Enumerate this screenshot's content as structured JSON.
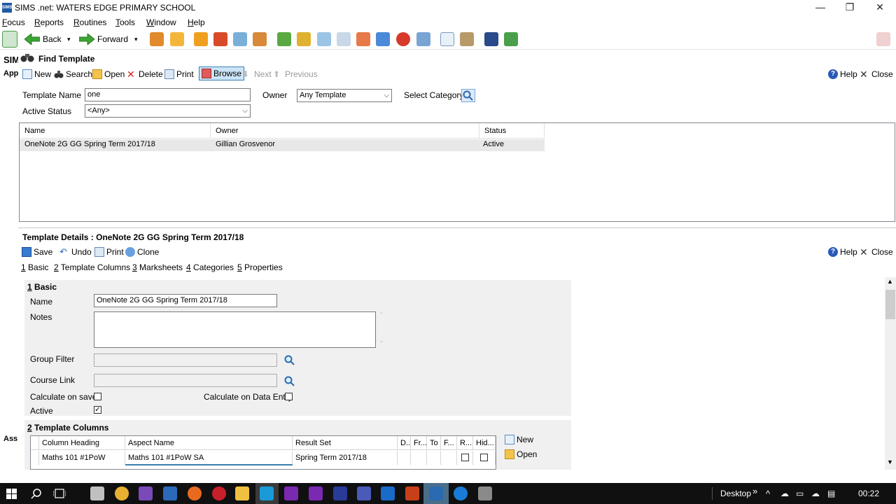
{
  "window": {
    "title": "SIMS .net: WATERS EDGE PRIMARY SCHOOL",
    "app_icon_text": "SIMS",
    "minimize": "—",
    "restore": "❐",
    "close": "✕"
  },
  "menu": {
    "focus_first": "F",
    "focus_rest": "ocus",
    "reports_first": "R",
    "reports_rest": "eports",
    "routines_first": "R",
    "routines_rest": "outines",
    "tools_first": "T",
    "tools_rest": "ools",
    "window_first": "W",
    "window_rest": "indow",
    "help_first": "H",
    "help_rest": "elp"
  },
  "toolbar": {
    "back_label": "Back",
    "forward_label": "Forward",
    "dropdown_glyph": "▾"
  },
  "leftstrip": {
    "line1": "SIM",
    "line2": "App",
    "line3": "Ass"
  },
  "find": {
    "title": "Find Template",
    "cmd_new": "New",
    "cmd_search": "Search",
    "cmd_open": "Open",
    "cmd_delete": "Delete",
    "cmd_print": "Print",
    "cmd_browse": "Browse",
    "cmd_next": "Next",
    "cmd_previous": "Previous",
    "cmd_help": "Help",
    "cmd_close": "Close",
    "template_name_label": "Template Name",
    "template_name_value": "one",
    "owner_label": "Owner",
    "owner_value": "Any Template",
    "select_category_label": "Select Category",
    "active_status_label": "Active Status",
    "active_status_value": "<Any>",
    "columns": {
      "name": "Name",
      "owner": "Owner",
      "status": "Status"
    },
    "rows": [
      {
        "name": "OneNote 2G GG Spring Term 2017/18",
        "owner": "Gillian Grosvenor",
        "status": "Active"
      }
    ]
  },
  "details": {
    "title": "Template Details : OneNote 2G GG Spring Term 2017/18",
    "cmd_save": "Save",
    "cmd_undo": "Undo",
    "cmd_print": "Print",
    "cmd_clone": "Clone",
    "cmd_help": "Help",
    "cmd_close": "Close",
    "tabs": [
      {
        "num": "1",
        "label": " Basic"
      },
      {
        "num": "2",
        "label": " Template Columns"
      },
      {
        "num": "3",
        "label": " Marksheets"
      },
      {
        "num": "4",
        "label": " Categories"
      },
      {
        "num": "5",
        "label": " Properties"
      }
    ],
    "basic": {
      "section_num": "1",
      "section_title": " Basic",
      "name_label": "Name",
      "name_value": "OneNote 2G GG Spring Term 2017/18",
      "notes_label": "Notes",
      "notes_value": "",
      "group_filter_label": "Group Filter",
      "course_link_label": "Course Link",
      "calc_on_save_label": "Calculate on save",
      "calc_on_save": false,
      "calc_on_entry_label": "Calculate on Data Entry",
      "calc_on_entry": false,
      "active_label": "Active",
      "active": true,
      "check_mark": "✓"
    },
    "columns_section": {
      "section_num": "2",
      "section_title": " Template Columns",
      "headers": [
        "Column Heading",
        "Aspect Name",
        "Result Set",
        "D...",
        "Fr...",
        "To",
        "F...",
        "R...",
        "Hid..."
      ],
      "rows": [
        {
          "heading": "Maths 101 #1PoW",
          "aspect": "Maths 101 #1PoW SA",
          "result_set": "Spring Term 2017/18"
        }
      ],
      "cmd_new": "New",
      "cmd_open": "Open"
    }
  },
  "taskbar": {
    "desktop_label": "Desktop",
    "chevrons": "»",
    "caret": "^",
    "time": "00:22"
  },
  "colors": {
    "accent_blue": "#1d5aa5",
    "browse_highlight": "#cce4f7",
    "selected_row": "#e8e8e8",
    "section_bg": "#f0f0f0",
    "taskbar_bg": "#101010",
    "sims_active_task": "#4a6e8a"
  }
}
